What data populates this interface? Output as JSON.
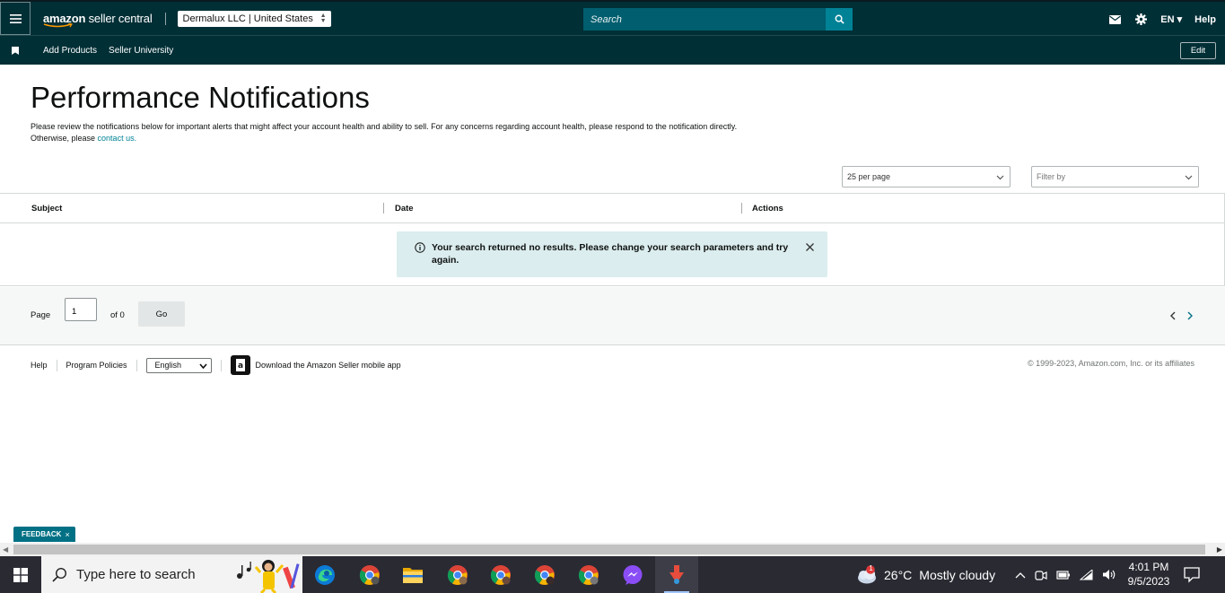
{
  "header": {
    "logo_text_bold": "amazon",
    "logo_text_rest": " seller central",
    "account_selector": "Dermalux LLC | United States",
    "search_placeholder": "Search",
    "language": "EN",
    "help_label": "Help"
  },
  "nav": {
    "links": [
      "Add Products",
      "Seller University"
    ],
    "edit_label": "Edit"
  },
  "page": {
    "title": "Performance Notifications",
    "intro_line1": "Please review the notifications below for important alerts that might affect your account health and ability to sell. For any concerns regarding account health, please respond to the notification directly.",
    "intro_line2_prefix": "Otherwise, please ",
    "intro_link": "contact us.",
    "per_page": "25 per page",
    "filter_placeholder": "Filter by"
  },
  "table": {
    "columns": [
      "Subject",
      "Date",
      "Actions"
    ],
    "empty_message": "Your search returned no results. Please change your search parameters and try again."
  },
  "pager": {
    "page_label": "Page",
    "current_page": "1",
    "of_label": "of 0",
    "go_label": "Go"
  },
  "footer": {
    "help": "Help",
    "program_policies": "Program Policies",
    "language": "English",
    "app_text": "Download the Amazon Seller mobile app",
    "copyright": "© 1999-2023, Amazon.com, Inc. or its affiliates"
  },
  "feedback": {
    "label": "FEEDBACK",
    "close": "×"
  },
  "taskbar": {
    "search_placeholder": "Type here to search",
    "weather_temp": "26°C",
    "weather_text": "Mostly cloudy",
    "weather_badge": "1",
    "time": "4:01 PM",
    "date": "9/5/2023"
  },
  "colors": {
    "header_bg": "#002f36",
    "search_bg": "#005e6e",
    "accent": "#008296",
    "alert_bg": "#dbedee",
    "taskbar_bg": "#2a2a33"
  }
}
